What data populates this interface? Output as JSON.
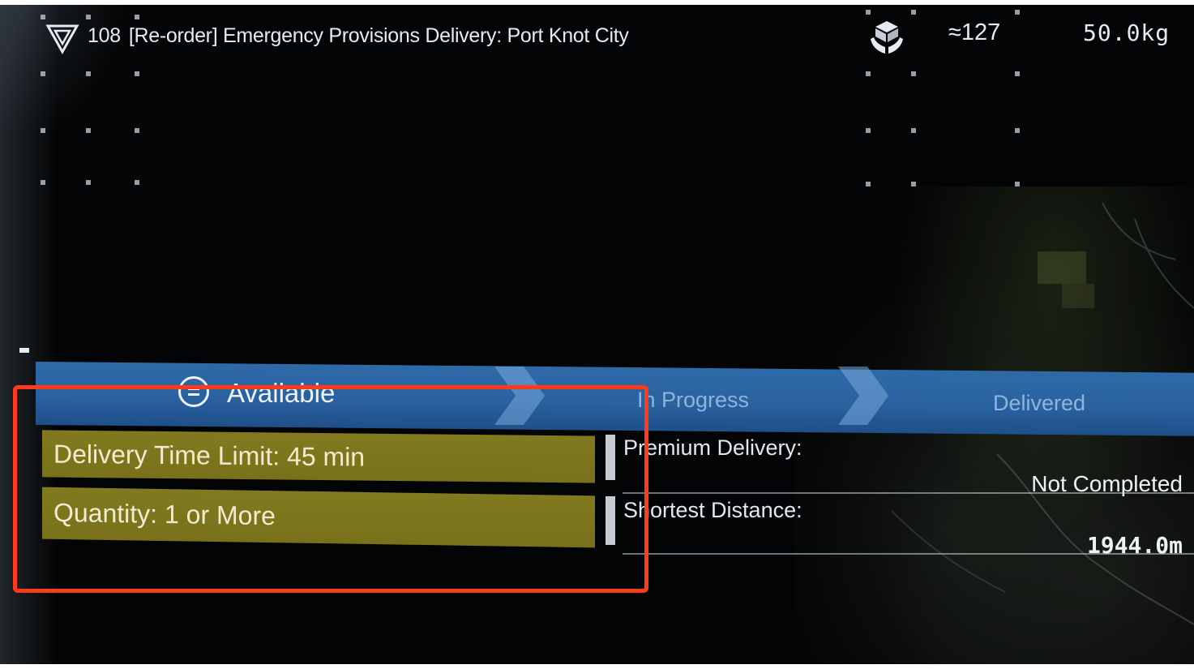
{
  "header": {
    "order_id": "108",
    "order_title": "[Re-order] Emergency Provisions Delivery: Port Knot City",
    "cargo_count": "≈127",
    "weight": "50.0kg"
  },
  "status": {
    "stages": [
      "Available",
      "In Progress",
      "Delivered"
    ],
    "current": "Available"
  },
  "conditions": [
    "Delivery Time Limit: 45 min",
    "Quantity: 1 or More"
  ],
  "info": {
    "premium_label": "Premium Delivery:",
    "premium_value": "Not Completed",
    "distance_label": "Shortest Distance:",
    "distance_value": "1944.0m"
  },
  "colors": {
    "strip": "#2f6aa8",
    "condition_box": "#817a1f",
    "highlight": "#ff3b1c"
  },
  "icons": [
    "order-triangle-icon",
    "cargo-hands-icon",
    "available-status-icon"
  ]
}
